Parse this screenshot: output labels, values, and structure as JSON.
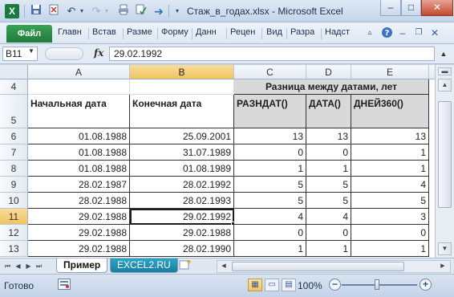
{
  "window": {
    "title": "Стаж_в_годах.xlsx - Microsoft Excel",
    "controls": {
      "minimize": "–",
      "maximize": "□",
      "close": "✕"
    }
  },
  "quick_access": {
    "app_icon": "X",
    "icons": [
      "save-icon",
      "print-preview-icon",
      "undo-icon",
      "redo-icon",
      "print-icon",
      "spellcheck-icon",
      "customize-icon"
    ]
  },
  "ribbon": {
    "file_tab": "Файл",
    "tabs": [
      "Главн",
      "Встав",
      "Разме",
      "Форму",
      "Данн",
      "Рецен",
      "Вид",
      "Разра",
      "Надст"
    ],
    "right_icons": [
      "minimize-ribbon-icon",
      "help-icon",
      "restore-workbook-icon",
      "close-workbook-icon"
    ]
  },
  "formula_bar": {
    "name_box": "B11",
    "fx_label": "fx",
    "formula": "29.02.1992"
  },
  "grid": {
    "columns": [
      "A",
      "B",
      "C",
      "D",
      "E"
    ],
    "selected_column": "B",
    "header_group": "Разница между датами, лет",
    "header_labels": {
      "a": "Начальная дата",
      "b": "Конечная дата",
      "c": "РАЗНДАТ()",
      "d": "ДАТА()",
      "e": "ДНЕЙ360()"
    },
    "header_row_numbers": [
      "4",
      "5"
    ],
    "rows": [
      {
        "num": "6",
        "a": "01.08.1988",
        "b": "25.09.2001",
        "c": "13",
        "d": "13",
        "e": "13"
      },
      {
        "num": "7",
        "a": "01.08.1988",
        "b": "31.07.1989",
        "c": "0",
        "d": "0",
        "e": "1"
      },
      {
        "num": "8",
        "a": "01.08.1988",
        "b": "01.08.1989",
        "c": "1",
        "d": "1",
        "e": "1"
      },
      {
        "num": "9",
        "a": "28.02.1987",
        "b": "28.02.1992",
        "c": "5",
        "d": "5",
        "e": "4"
      },
      {
        "num": "10",
        "a": "28.02.1988",
        "b": "28.02.1993",
        "c": "5",
        "d": "5",
        "e": "5"
      },
      {
        "num": "11",
        "a": "29.02.1988",
        "b": "29.02.1992",
        "c": "4",
        "d": "4",
        "e": "3"
      },
      {
        "num": "12",
        "a": "29.02.1988",
        "b": "29.02.1988",
        "c": "0",
        "d": "0",
        "e": "0"
      },
      {
        "num": "13",
        "a": "29.02.1988",
        "b": "28.02.1990",
        "c": "1",
        "d": "1",
        "e": "1"
      }
    ],
    "active_cell": "B11"
  },
  "sheets": {
    "tabs": [
      "Пример",
      "EXCEL2.RU"
    ],
    "active": "Пример"
  },
  "status_bar": {
    "status": "Готово",
    "zoom": "100%",
    "zoom_minus": "−",
    "zoom_plus": "+"
  }
}
